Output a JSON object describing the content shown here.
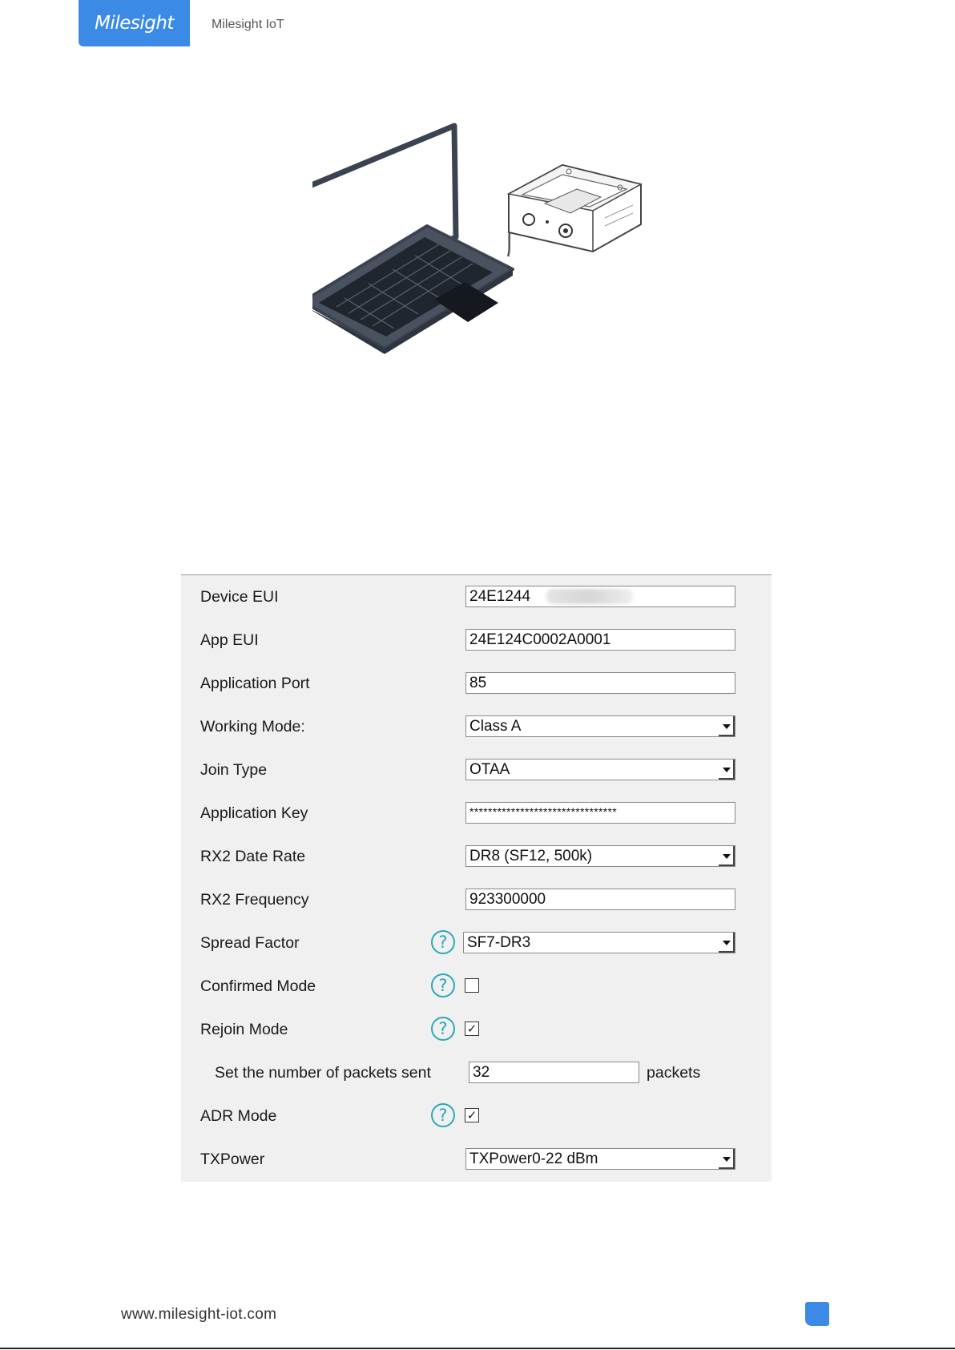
{
  "header": {
    "logo_text": "Milesight",
    "brand": "Milesight IoT"
  },
  "settings": {
    "rows": [
      {
        "label": "Device EUI",
        "value": "24E1244"
      },
      {
        "label": "App EUI",
        "value": "24E124C0002A0001"
      },
      {
        "label": "Application Port",
        "value": "85"
      },
      {
        "label": "Working Mode:",
        "value": "Class A"
      },
      {
        "label": "Join Type",
        "value": "OTAA"
      },
      {
        "label": "Application Key",
        "value": "********************************"
      },
      {
        "label": "RX2 Date Rate",
        "value": "DR8 (SF12, 500k)"
      },
      {
        "label": "RX2 Frequency",
        "value": "923300000"
      },
      {
        "label": "Spread Factor",
        "value": "SF7-DR3"
      },
      {
        "label": "Confirmed Mode",
        "checked": false
      },
      {
        "label": "Rejoin Mode",
        "checked": true
      },
      {
        "label": "Set the number of packets sent",
        "value": "32",
        "suffix": "packets"
      },
      {
        "label": "ADR Mode",
        "checked": true
      },
      {
        "label": "TXPower",
        "value": "TXPower0-22 dBm"
      }
    ],
    "help_glyph": "?",
    "check_glyph": "✓"
  },
  "footer": {
    "url": "www.milesight-iot.com"
  },
  "colors": {
    "brand_blue": "#3b8be6",
    "help_teal": "#2aa8b8",
    "panel_bg": "#f0f0f0"
  },
  "icons": {
    "help": "question-circle-icon",
    "illustration": "laptop-connected-device-illustration"
  }
}
